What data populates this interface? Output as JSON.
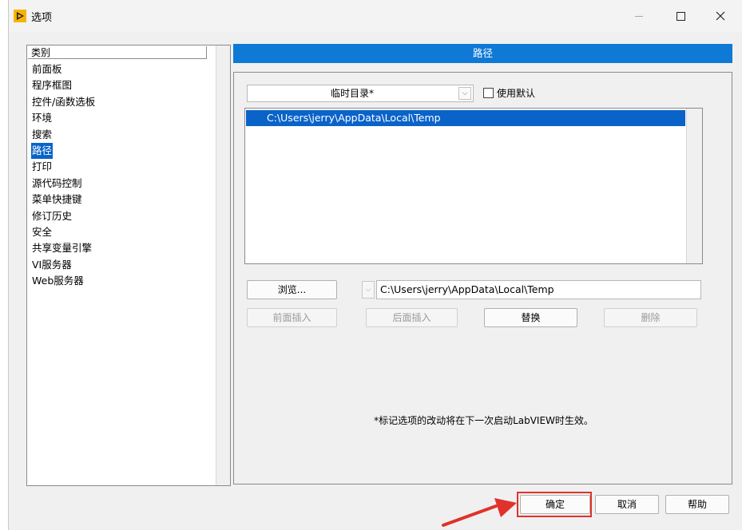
{
  "window": {
    "title": "选项",
    "icons": {
      "app": "labview-app-icon",
      "minimize": "minimize-icon",
      "maximize": "maximize-icon",
      "close": "close-icon"
    }
  },
  "categories": {
    "header": "类别",
    "items": [
      "前面板",
      "程序框图",
      "控件/函数选板",
      "环境",
      "搜索",
      "路径",
      "打印",
      "源代码控制",
      "菜单快捷键",
      "修订历史",
      "安全",
      "共享变量引擎",
      "VI服务器",
      "Web服务器"
    ],
    "selected": "路径"
  },
  "panel": {
    "title": "路径",
    "path_type": "临时目录*",
    "use_default_label": "使用默认",
    "use_default_checked": false,
    "paths": [
      "C:\\Users\\jerry\\AppData\\Local\\Temp"
    ],
    "browse_label": "浏览...",
    "path_input_value": "C:\\Users\\jerry\\AppData\\Local\\Temp",
    "insert_before_label": "前面插入",
    "insert_after_label": "后面插入",
    "replace_label": "替换",
    "delete_label": "删除",
    "notice": "*标记选项的改动将在下一次启动LabVIEW时生效。"
  },
  "footer": {
    "ok_label": "确定",
    "cancel_label": "取消",
    "help_label": "帮助"
  },
  "colors": {
    "accent": "#0f79d6",
    "selection": "#0a63c9",
    "annotation": "#e0322b"
  }
}
